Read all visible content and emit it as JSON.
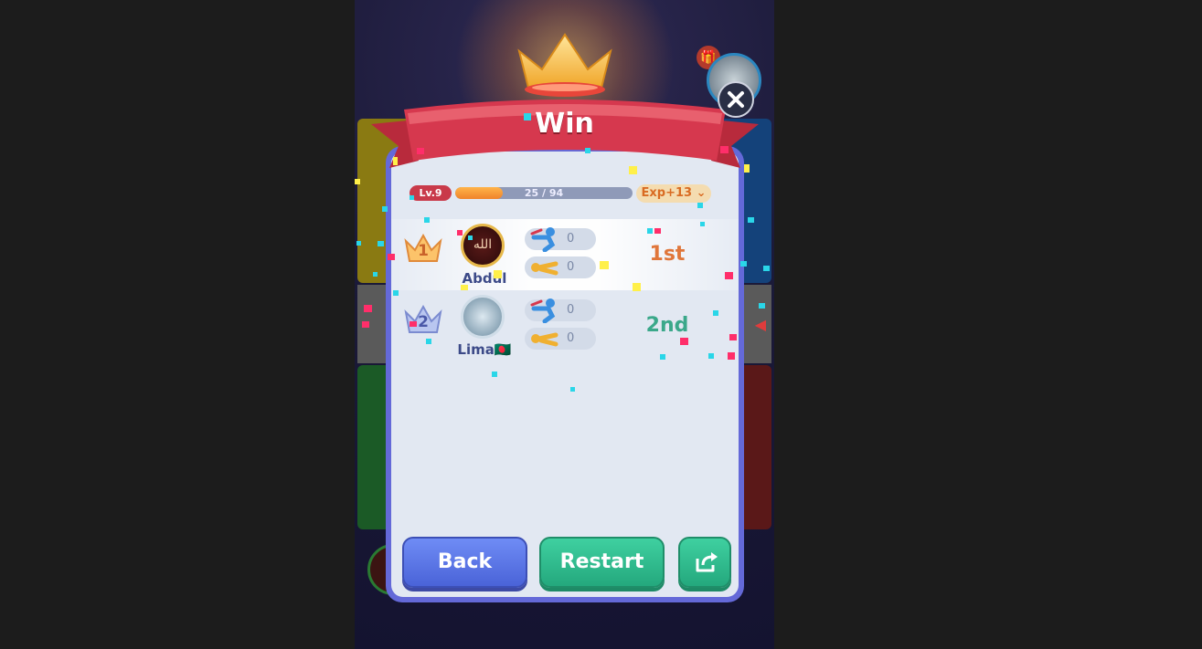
{
  "result": {
    "title": "Win",
    "level": "Lv.9",
    "xp_current": 25,
    "xp_max": 94,
    "xp_text": "25 / 94",
    "exp_gain": "Exp+13"
  },
  "players": [
    {
      "rank": "1",
      "name": "Abdul",
      "avatar_text": "الله",
      "kills": "0",
      "deaths": "0",
      "place": "1st",
      "place_color": "#e0763a"
    },
    {
      "rank": "2",
      "name": "Lima🇧🇩",
      "avatar_text": "",
      "kills": "0",
      "deaths": "0",
      "place": "2nd",
      "place_color": "#3aa88a"
    }
  ],
  "buttons": {
    "back": "Back",
    "restart": "Restart"
  },
  "icons": {
    "close": "close-icon",
    "share": "share-icon",
    "gift": "gift-icon",
    "crown": "crown-icon"
  },
  "colors": {
    "panel_border": "#6469d8",
    "ribbon": "#d6384e",
    "back_button": "#5a74e6",
    "restart_button": "#2fbc8e"
  }
}
